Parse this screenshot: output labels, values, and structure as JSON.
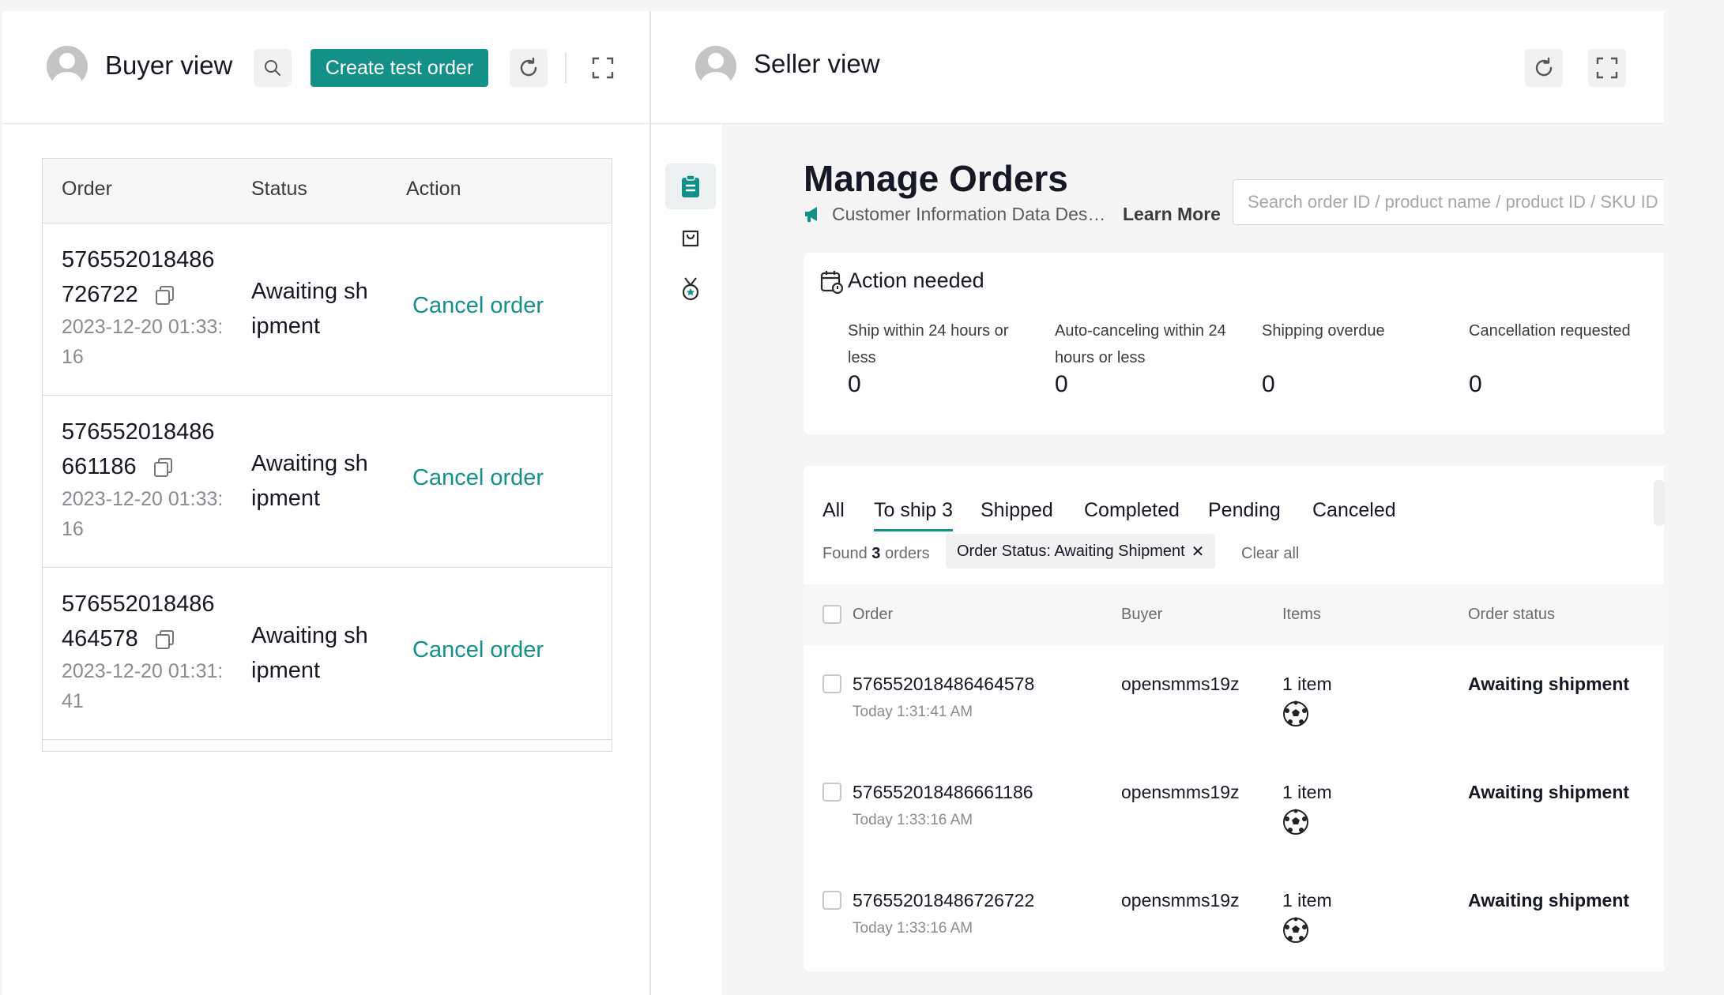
{
  "buyer": {
    "title": "Buyer view",
    "create_button": "Create test order",
    "table": {
      "headers": [
        "Order",
        "Status",
        "Action"
      ],
      "rows": [
        {
          "order_id": "576552018486726722",
          "date": "2023-12-20 01:33:16",
          "status": "Awaiting shipment",
          "action": "Cancel order"
        },
        {
          "order_id": "576552018486661186",
          "date": "2023-12-20 01:33:16",
          "status": "Awaiting shipment",
          "action": "Cancel order"
        },
        {
          "order_id": "576552018486464578",
          "date": "2023-12-20 01:31:41",
          "status": "Awaiting shipment",
          "action": "Cancel order"
        }
      ]
    }
  },
  "seller": {
    "title": "Seller view",
    "rail_icons": [
      "orders-clipboard-icon",
      "shopping-bag-icon",
      "medal-icon"
    ],
    "page_title": "Manage Orders",
    "notice_text": "Customer Information Data Desensitization",
    "learn_more": "Learn More",
    "search_placeholder": "Search order ID / product name / product ID / SKU ID",
    "action_needed": {
      "title": "Action needed",
      "items": [
        {
          "label": "Ship within 24 hours or less",
          "count": "0"
        },
        {
          "label": "Auto-canceling within 24 hours or less",
          "count": "0"
        },
        {
          "label": "Shipping overdue",
          "count": "0"
        },
        {
          "label": "Cancellation requested",
          "count": "0"
        }
      ]
    },
    "tabs": [
      "All",
      "To ship 3",
      "Shipped",
      "Completed",
      "Pending",
      "Canceled"
    ],
    "active_tab": "To ship 3",
    "found_prefix": "Found",
    "found_count": "3",
    "found_suffix": "orders",
    "filter_chip": "Order Status:  Awaiting Shipment",
    "clear_all": "Clear all",
    "grid_headers": {
      "order": "Order",
      "buyer": "Buyer",
      "items": "Items",
      "status": "Order status"
    },
    "orders": [
      {
        "order_id": "576552018486464578",
        "time": "Today 1:31:41 AM",
        "buyer": "opensmms19z",
        "items": "1 item",
        "status": "Awaiting shipment"
      },
      {
        "order_id": "576552018486661186",
        "time": "Today 1:33:16 AM",
        "buyer": "opensmms19z",
        "items": "1 item",
        "status": "Awaiting shipment"
      },
      {
        "order_id": "576552018486726722",
        "time": "Today 1:33:16 AM",
        "buyer": "opensmms19z",
        "items": "1 item",
        "status": "Awaiting shipment"
      }
    ]
  },
  "colors": {
    "accent": "#139088",
    "page_bg": "#f5f5f5",
    "text": "#161823",
    "muted": "#8a8b91"
  }
}
